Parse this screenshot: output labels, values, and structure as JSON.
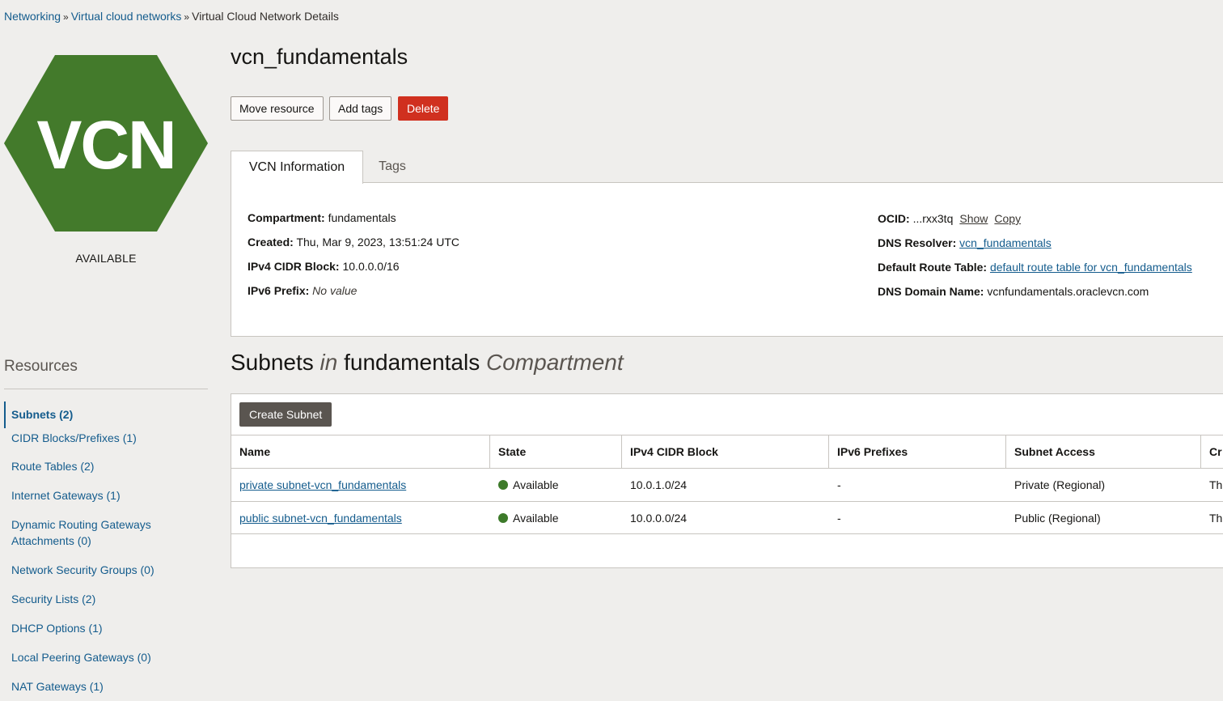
{
  "breadcrumb": {
    "items": [
      "Networking",
      "Virtual cloud networks",
      "Virtual Cloud Network Details"
    ],
    "separator": "»"
  },
  "resource": {
    "badge_text": "VCN",
    "badge_color": "#437a2b",
    "status": "AVAILABLE",
    "name": "vcn_fundamentals"
  },
  "actions": {
    "move": "Move resource",
    "add_tags": "Add tags",
    "delete": "Delete"
  },
  "tabs": [
    {
      "label": "VCN Information",
      "active": true
    },
    {
      "label": "Tags",
      "active": false
    }
  ],
  "info": {
    "compartment_label": "Compartment:",
    "compartment_value": "fundamentals",
    "created_label": "Created:",
    "created_value": "Thu, Mar 9, 2023, 13:51:24 UTC",
    "ipv4_label": "IPv4 CIDR Block:",
    "ipv4_value": "10.0.0.0/16",
    "ipv6_label": "IPv6 Prefix:",
    "ipv6_value": "No value",
    "ocid_label": "OCID:",
    "ocid_value": "...rxx3tq",
    "ocid_show": "Show",
    "ocid_copy": "Copy",
    "dns_resolver_label": "DNS Resolver:",
    "dns_resolver_value": "vcn_fundamentals",
    "route_table_label": "Default Route Table:",
    "route_table_value": "default route table for vcn_fundamentals",
    "dns_domain_label": "DNS Domain Name:",
    "dns_domain_value": "vcnfundamentals.oraclevcn.com"
  },
  "sidebar": {
    "title": "Resources",
    "items": [
      {
        "label": "Subnets (2)",
        "active": true
      },
      {
        "label": "CIDR Blocks/Prefixes (1)"
      },
      {
        "label": "Route Tables (2)"
      },
      {
        "label": "Internet Gateways (1)"
      },
      {
        "label": "Dynamic Routing Gateways Attachments (0)"
      },
      {
        "label": "Network Security Groups (0)"
      },
      {
        "label": "Security Lists (2)"
      },
      {
        "label": "DHCP Options (1)"
      },
      {
        "label": "Local Peering Gateways (0)"
      },
      {
        "label": "NAT Gateways (1)"
      }
    ]
  },
  "subnets": {
    "title_part1": "Subnets",
    "title_in": "in",
    "title_compartment": "fundamentals",
    "title_suffix": "Compartment",
    "create_button": "Create Subnet",
    "columns": [
      "Name",
      "State",
      "IPv4 CIDR Block",
      "IPv6 Prefixes",
      "Subnet Access",
      "Cr"
    ],
    "rows": [
      {
        "name": "private subnet-vcn_fundamentals",
        "state": "Available",
        "ipv4": "10.0.1.0/24",
        "ipv6": "-",
        "access": "Private (Regional)",
        "extra": "Th"
      },
      {
        "name": "public subnet-vcn_fundamentals",
        "state": "Available",
        "ipv4": "10.0.0.0/24",
        "ipv6": "-",
        "access": "Public (Regional)",
        "extra": "Th"
      }
    ],
    "state_color": "#3d7a2a"
  }
}
